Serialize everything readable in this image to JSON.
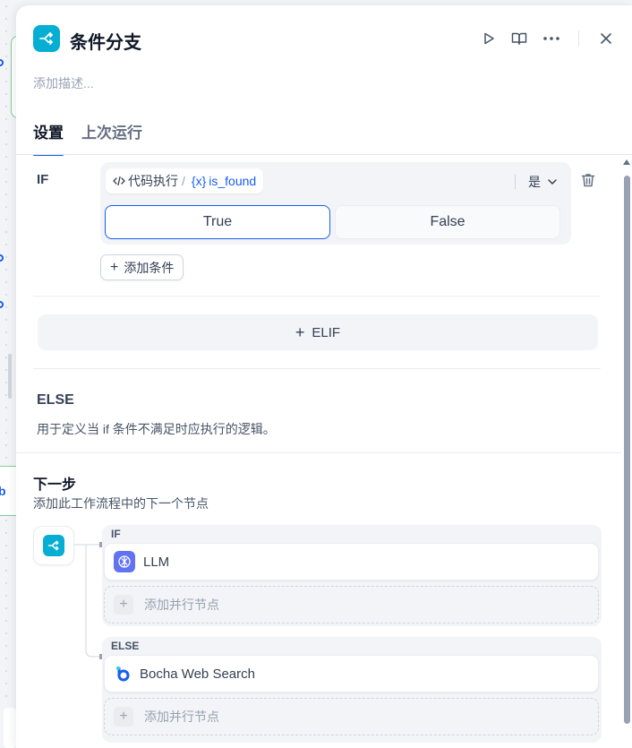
{
  "header": {
    "title": "条件分支",
    "description_placeholder": "添加描述..."
  },
  "tabs": [
    {
      "label": "设置",
      "active": true
    },
    {
      "label": "上次运行",
      "active": false
    }
  ],
  "if_case": {
    "label": "IF",
    "condition": {
      "source_node": "代码执行",
      "separator": "/",
      "variable_prefix": "{x}",
      "variable": "is_found",
      "operator": "是",
      "options": [
        "True",
        "False"
      ],
      "selected": "True"
    },
    "add_condition_label": "添加条件"
  },
  "elif_button": "ELIF",
  "else_case": {
    "label": "ELSE",
    "description": "用于定义当 if 条件不满足时应执行的逻辑。"
  },
  "next_step": {
    "title": "下一步",
    "description": "添加此工作流程中的下一个节点",
    "branches": [
      {
        "label": "IF",
        "target": "LLM",
        "add_parallel": "添加并行节点"
      },
      {
        "label": "ELSE",
        "target": "Bocha Web Search",
        "add_parallel": "添加并行节点"
      }
    ]
  },
  "colors": {
    "accent": "#155eef",
    "node_icon": "#06aed4",
    "llm_icon": "#6172f3"
  }
}
